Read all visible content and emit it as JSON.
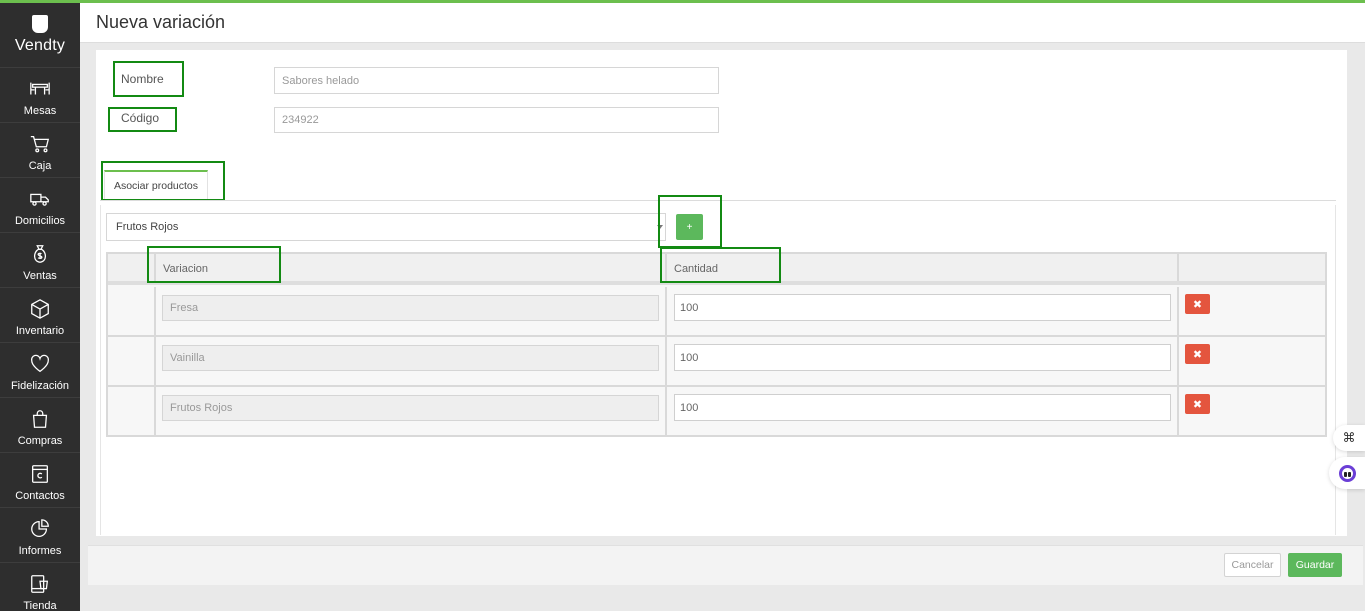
{
  "app": {
    "brand": "Vendty",
    "page_title": "Nueva variación"
  },
  "sidebar": {
    "items": [
      {
        "label": "Mesas",
        "icon": "tables-icon"
      },
      {
        "label": "Caja",
        "icon": "cart-icon"
      },
      {
        "label": "Domicilios",
        "icon": "delivery-truck-icon"
      },
      {
        "label": "Ventas",
        "icon": "money-bag-icon"
      },
      {
        "label": "Inventario",
        "icon": "box-icon"
      },
      {
        "label": "Fidelización",
        "icon": "heart-icon"
      },
      {
        "label": "Compras",
        "icon": "shopping-bag-icon"
      },
      {
        "label": "Contactos",
        "icon": "contacts-icon"
      },
      {
        "label": "Informes",
        "icon": "pie-chart-icon"
      },
      {
        "label": "Tienda",
        "icon": "store-icon"
      }
    ]
  },
  "form": {
    "nombre_label": "Nombre",
    "nombre_value": "Sabores helado",
    "codigo_label": "Código",
    "codigo_value": "234922"
  },
  "tabs": {
    "asociar_label": "Asociar productos"
  },
  "selector": {
    "selected": "Frutos Rojos",
    "add_label": "+"
  },
  "table": {
    "headers": {
      "variacion": "Variacion",
      "cantidad": "Cantidad"
    },
    "rows": [
      {
        "variacion": "Fresa",
        "cantidad": "100"
      },
      {
        "variacion": "Vainilla",
        "cantidad": "100"
      },
      {
        "variacion": "Frutos Rojos",
        "cantidad": "100"
      }
    ],
    "delete_symbol": "✖"
  },
  "footer": {
    "cancel_label": "Cancelar",
    "save_label": "Guardar"
  },
  "colors": {
    "accent_green": "#5cb85c",
    "danger_red": "#e4553e",
    "sidebar_bg": "#2e2e2e",
    "highlight_box": "#138a13"
  }
}
